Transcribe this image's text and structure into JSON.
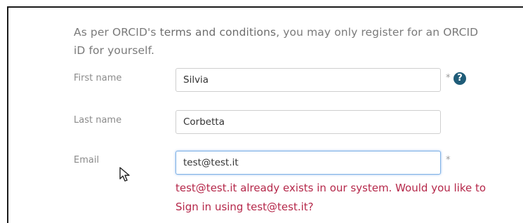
{
  "intro": {
    "prefix": "As per ORCID's ",
    "link": "terms and conditions",
    "suffix": ", you may only register for an ORCID iD for yourself."
  },
  "form": {
    "first_name": {
      "label": "First name",
      "value": "Silvia",
      "required": "*"
    },
    "last_name": {
      "label": "Last name",
      "value": "Corbetta"
    },
    "email": {
      "label": "Email",
      "value": "test@test.it",
      "required": "*"
    },
    "help_icon": "?"
  },
  "error": {
    "prefix": "test@test.it already exists in our system. Would you like to ",
    "signin": "Sign in",
    "suffix": " using test@test.it?"
  },
  "icons": {
    "help": "question-circle-icon",
    "cursor": "mouse-pointer-icon"
  },
  "colors": {
    "error": "#b5284a",
    "help_icon_bg": "#1f5c78",
    "focus_border": "#7fb2e6"
  }
}
